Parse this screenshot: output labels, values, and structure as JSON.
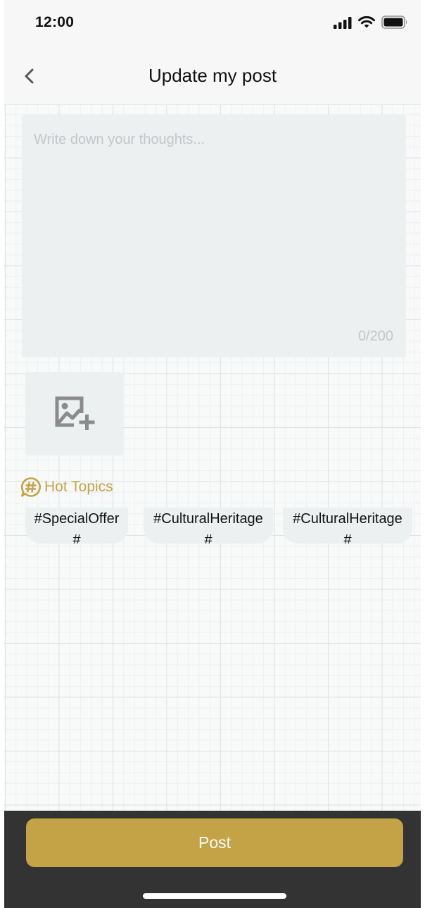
{
  "status_bar": {
    "time": "12:00",
    "icons": [
      "signal-icon",
      "wifi-icon",
      "battery-icon"
    ]
  },
  "navbar": {
    "back_icon": "chevron-left-icon",
    "title": "Update my post"
  },
  "editor": {
    "placeholder": "Write down your thoughts...",
    "value": "",
    "char_count": "0/200"
  },
  "add_image": {
    "icon": "image-add-icon"
  },
  "hot_topics": {
    "icon": "hashtag-chat-icon",
    "label": "Hot Topics",
    "items": [
      {
        "line1": "#SpecialOffer",
        "line2": "#"
      },
      {
        "line1": "#CulturalHeritage",
        "line2": "#"
      },
      {
        "line1": "#CulturalHeritage",
        "line2": "#"
      }
    ]
  },
  "footer": {
    "post_label": "Post"
  },
  "colors": {
    "accent": "#c4a346",
    "footer_bg": "#333333",
    "input_bg": "#ecf0f1",
    "placeholder": "#c3c6c8"
  }
}
